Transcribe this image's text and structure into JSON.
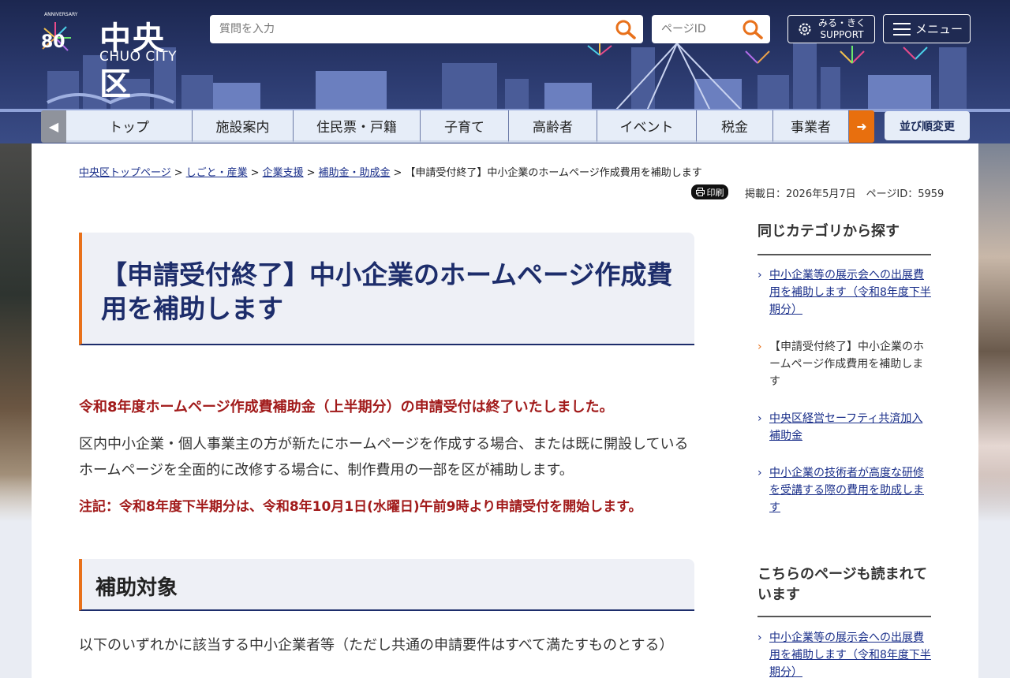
{
  "header": {
    "logo_title": "中央区",
    "logo_sub": "CHUO CITY",
    "anniversary_text": "ANNIVERSARY",
    "anniversary_number": "80",
    "search_placeholder": "質問を入力",
    "page_id_placeholder": "ページID",
    "support_line1": "みる・きく",
    "support_line2": "SUPPORT",
    "menu_label": "メニュー",
    "sort_label": "並び順変更"
  },
  "nav": {
    "items": [
      "トップ",
      "施設案内",
      "住民票・戸籍",
      "子育て",
      "高齢者",
      "イベント",
      "税金",
      "事業者"
    ]
  },
  "breadcrumb": {
    "items": [
      "中央区トップページ",
      "しごと・産業",
      "企業支援",
      "補助金・助成金"
    ],
    "current": "【申請受付終了】中小企業のホームページ作成費用を補助します",
    "separator": ">"
  },
  "meta": {
    "print_label": "印刷",
    "published": "掲載日：2026年5月7日　ページID：5959"
  },
  "article": {
    "title": "【申請受付終了】中小企業のホームページ作成費用を補助します",
    "notice": "令和8年度ホームページ作成費補助金（上半期分）の申請受付は終了いたしました。",
    "body": "区内中小企業・個人事業主の方が新たにホームページを作成する場合、または既に開設しているホームページを全面的に改修する場合に、制作費用の一部を区が補助します。",
    "note": "注記：令和8年度下半期分は、令和8年10月1日(水曜日)午前9時より申請受付を開始します。",
    "section1_title": "補助対象",
    "section1_text": "以下のいずれかに該当する中小企業者等（ただし共通の申請要件はすべて満たすものとする）"
  },
  "sidebar": {
    "category_title": "同じカテゴリから探す",
    "category_links": [
      "中小企業等の展示会への出展費用を補助します（令和8年度下半期分）",
      "【申請受付終了】中小企業のホームページ作成費用を補助します",
      "中央区経営セーフティ共済加入補助金",
      "中小企業の技術者が高度な研修を受講する際の費用を助成します"
    ],
    "popular_title": "こちらのページも読まれています",
    "popular_links": [
      "中小企業等の展示会への出展費用を補助します（令和8年度下半期分）"
    ]
  },
  "colors": {
    "header_bg": "#23305a",
    "accent_orange": "#e8711b",
    "title_navy": "#1d2d6b",
    "notice_red": "#a11a1a",
    "link_blue": "#1a2f8a"
  }
}
